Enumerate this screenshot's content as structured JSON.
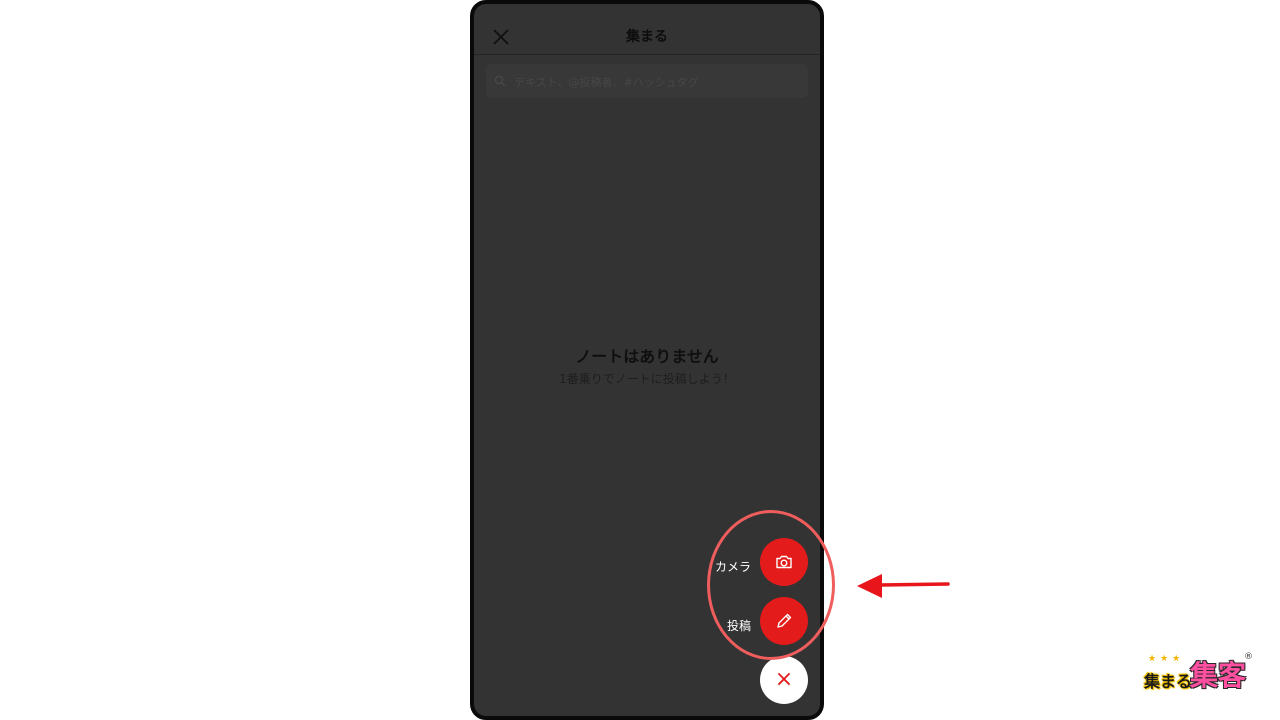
{
  "header": {
    "title": "集まる"
  },
  "search": {
    "placeholder": "テキスト、@投稿者、#ハッシュタグ"
  },
  "empty_state": {
    "title": "ノートはありません",
    "subtitle": "1番乗りでノートに投稿しよう！"
  },
  "fab_menu": {
    "camera_label": "カメラ",
    "post_label": "投稿",
    "close_symbol": "×"
  },
  "logo": {
    "stars": "★★★",
    "small_text": "集まる",
    "big_text": "集客",
    "registered": "®"
  },
  "colors": {
    "accent_red": "#e31b1b",
    "overlay": "#333333",
    "annotation_red": "#ef5d5d"
  },
  "icons": [
    "close-icon",
    "search-icon",
    "camera-icon",
    "pencil-icon",
    "arrow-left-icon"
  ]
}
